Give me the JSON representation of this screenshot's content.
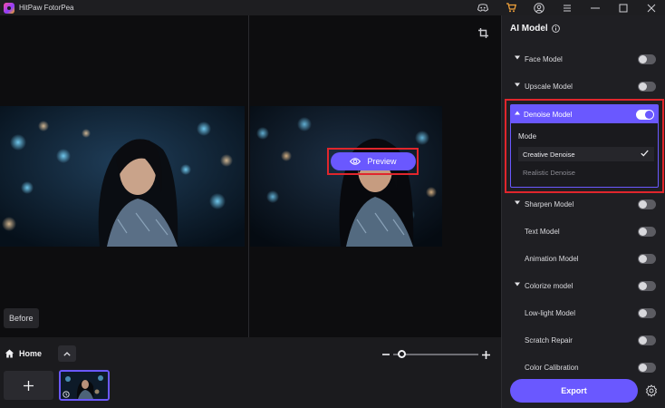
{
  "window": {
    "title": "HitPaw FotorPea",
    "icons": [
      "discord-icon",
      "cart-icon",
      "account-icon",
      "menu-icon",
      "minimize-icon",
      "maximize-icon",
      "close-icon"
    ]
  },
  "canvas": {
    "before_label": "Before",
    "preview_label": "Preview"
  },
  "bottom": {
    "home_label": "Home",
    "zoom_level": 0.1
  },
  "panel": {
    "title": "AI Model",
    "models": [
      {
        "label": "Face Model",
        "has_chevron": true,
        "enabled": false
      },
      {
        "label": "Upscale Model",
        "has_chevron": true,
        "enabled": false
      }
    ],
    "denoise": {
      "label": "Denoise Model",
      "enabled": true,
      "mode_label": "Mode",
      "options": [
        {
          "label": "Creative Denoise",
          "selected": true
        },
        {
          "label": "Realistic Denoise",
          "selected": false
        }
      ]
    },
    "models_below": [
      {
        "label": "Sharpen Model",
        "has_chevron": true,
        "enabled": false
      },
      {
        "label": "Text Model",
        "has_chevron": false,
        "enabled": false
      },
      {
        "label": "Animation Model",
        "has_chevron": false,
        "enabled": false
      },
      {
        "label": "Colorize model",
        "has_chevron": true,
        "enabled": false
      },
      {
        "label": "Low-light Model",
        "has_chevron": false,
        "enabled": false
      },
      {
        "label": "Scratch Repair",
        "has_chevron": false,
        "enabled": false
      },
      {
        "label": "Color Calibration",
        "has_chevron": false,
        "enabled": false
      }
    ],
    "export_label": "Export"
  },
  "colors": {
    "accent": "#6a58ff",
    "highlight_border": "#e0262c",
    "panel_bg": "#1f1f23"
  }
}
